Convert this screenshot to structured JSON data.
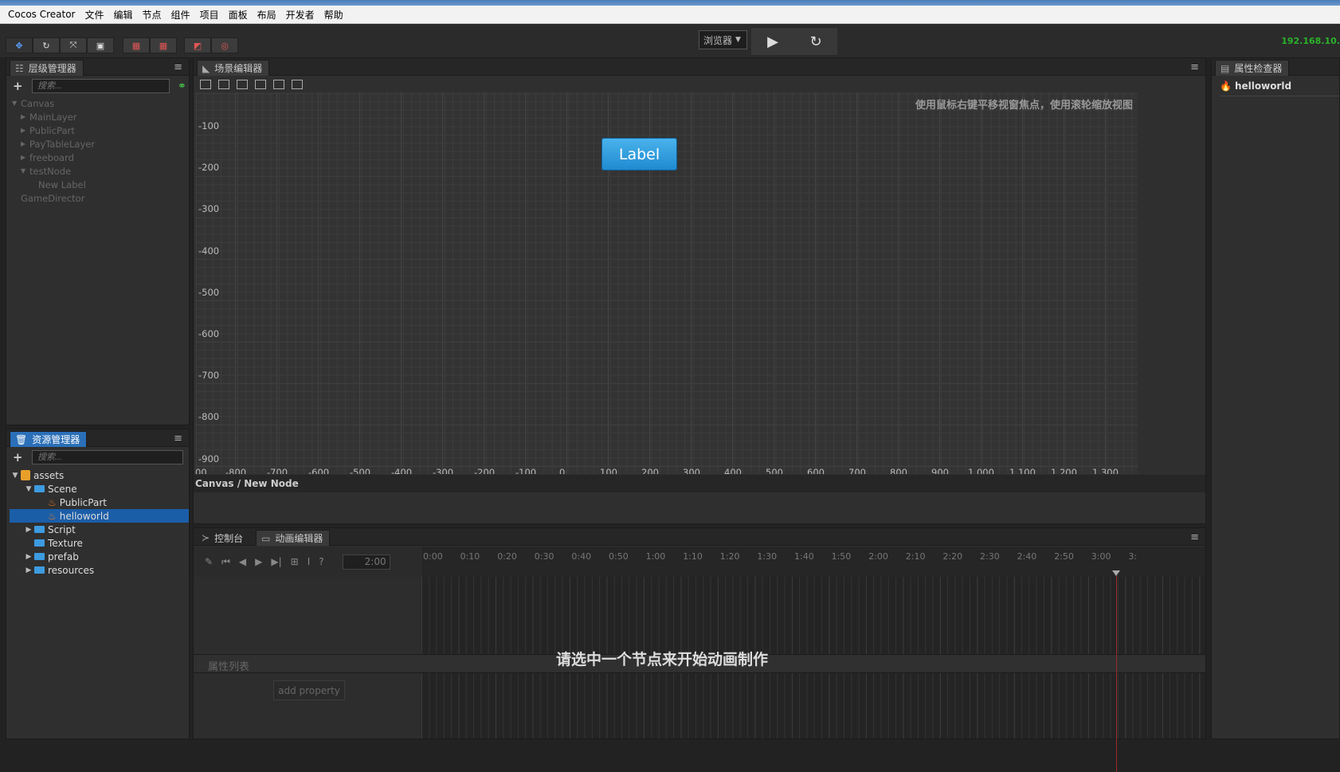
{
  "app": {
    "title": "Cocos Creator"
  },
  "menu": [
    "文件",
    "编辑",
    "节点",
    "组件",
    "项目",
    "面板",
    "布局",
    "开发者",
    "帮助"
  ],
  "toolbar": {
    "platform": "浏览器",
    "ip": "192.168.10."
  },
  "hierarchy": {
    "title": "层级管理器",
    "search_placeholder": "搜索...",
    "nodes": [
      {
        "label": "Canvas",
        "depth": 0,
        "arrow": "▼"
      },
      {
        "label": "MainLayer",
        "depth": 1,
        "arrow": "▶"
      },
      {
        "label": "PublicPart",
        "depth": 1,
        "arrow": "▶"
      },
      {
        "label": "PayTableLayer",
        "depth": 1,
        "arrow": "▶"
      },
      {
        "label": "freeboard",
        "depth": 1,
        "arrow": "▶"
      },
      {
        "label": "testNode",
        "depth": 1,
        "arrow": "▼"
      },
      {
        "label": "New Label",
        "depth": 2,
        "arrow": ""
      },
      {
        "label": "GameDirector",
        "depth": 0,
        "arrow": ""
      }
    ]
  },
  "assets": {
    "title": "资源管理器",
    "search_placeholder": "搜索...",
    "items": [
      {
        "label": "assets",
        "depth": 0,
        "arrow": "▼",
        "icon": "assets-icon",
        "selected": false
      },
      {
        "label": "Scene",
        "depth": 1,
        "arrow": "▼",
        "icon": "folder-icon",
        "selected": false
      },
      {
        "label": "PublicPart",
        "depth": 2,
        "arrow": "",
        "icon": "fire-icon",
        "selected": false
      },
      {
        "label": "helloworld",
        "depth": 2,
        "arrow": "",
        "icon": "fire-icon",
        "selected": true
      },
      {
        "label": "Script",
        "depth": 1,
        "arrow": "▶",
        "icon": "folder-icon",
        "selected": false
      },
      {
        "label": "Texture",
        "depth": 1,
        "arrow": "",
        "icon": "folder-icon",
        "selected": false
      },
      {
        "label": "prefab",
        "depth": 1,
        "arrow": "▶",
        "icon": "folder-icon",
        "selected": false
      },
      {
        "label": "resources",
        "depth": 1,
        "arrow": "▶",
        "icon": "folder-icon",
        "selected": false
      }
    ]
  },
  "scene": {
    "title": "场景编辑器",
    "hint": "使用鼠标右键平移视窗焦点，使用滚轮缩放视图",
    "y_ticks": [
      "-100",
      "-200",
      "-300",
      "-400",
      "-500",
      "-600",
      "-700",
      "-800",
      "-900"
    ],
    "x_ticks": [
      "00",
      "-800",
      "-700",
      "-600",
      "-500",
      "-400",
      "-300",
      "-200",
      "-100",
      "0",
      "100",
      "200",
      "300",
      "400",
      "500",
      "600",
      "700",
      "800",
      "900",
      "1,000",
      "1,100",
      "1,200",
      "1,300"
    ],
    "label_button": "Label",
    "breadcrumb": "Canvas / New Node"
  },
  "bottom": {
    "console_tab": "控制台",
    "anim_tab": "动画编辑器",
    "time_value": "2:00",
    "ruler": [
      "0:00",
      "0:10",
      "0:20",
      "0:30",
      "0:40",
      "0:50",
      "1:00",
      "1:10",
      "1:20",
      "1:30",
      "1:40",
      "1:50",
      "2:00",
      "2:10",
      "2:20",
      "2:30",
      "2:40",
      "2:50",
      "3:00",
      "3:"
    ],
    "prop_list_title": "属性列表",
    "add_property": "add property",
    "message": "请选中一个节点来开始动画制作"
  },
  "inspector": {
    "title": "属性检查器",
    "item": "helloworld"
  },
  "colors": {
    "accent": "#2a6fb8",
    "selection": "#1b5ea8",
    "button": "#1f8ad0",
    "ip": "#29b329"
  }
}
